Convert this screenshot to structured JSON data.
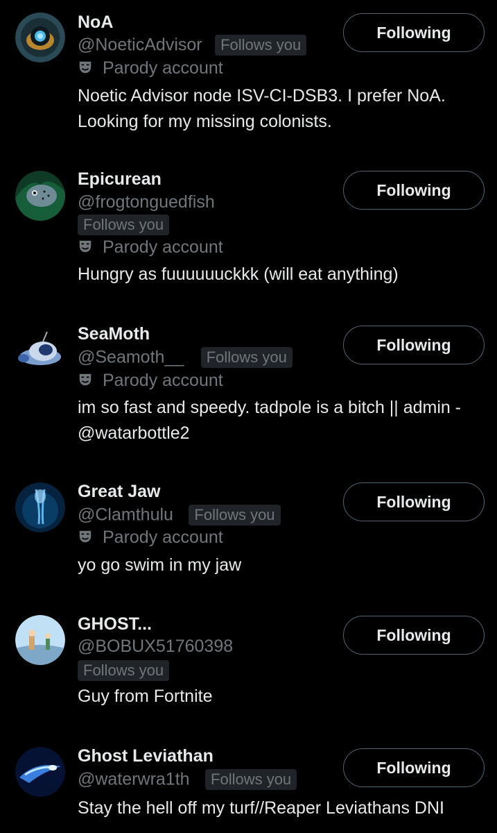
{
  "follow_button_label": "Following",
  "parody_label": "Parody account",
  "follows_you_label": "Follows you",
  "accounts": [
    {
      "name": "NoA",
      "handle": "@NoeticAdvisor",
      "bio": "Noetic Advisor node ISV-CI-DSB3. I prefer NoA. Looking for my missing colonists."
    },
    {
      "name": "Epicurean",
      "handle": "@frogtonguedfish",
      "bio": "Hungry as fuuuuuuckkk (will eat anything)"
    },
    {
      "name": "SeaMoth",
      "handle": "@Seamoth__",
      "bio": "im so fast and speedy. tadpole is a bitch || admin - @watarbottle2"
    },
    {
      "name": "Great Jaw",
      "handle": "@Clamthulu",
      "bio": "yo go swim in my jaw"
    },
    {
      "name": "GHOST...",
      "handle": "@BOBUX51760398",
      "bio": "Guy from Fortnite"
    },
    {
      "name": "Ghost Leviathan",
      "handle": "@waterwra1th",
      "bio": "Stay the hell off my turf//Reaper Leviathans DNI"
    }
  ],
  "colors": {
    "background": "#000000",
    "text": "#e7e9ea",
    "muted": "#71767b",
    "badge_bg": "#202327",
    "button_border": "#536471"
  }
}
